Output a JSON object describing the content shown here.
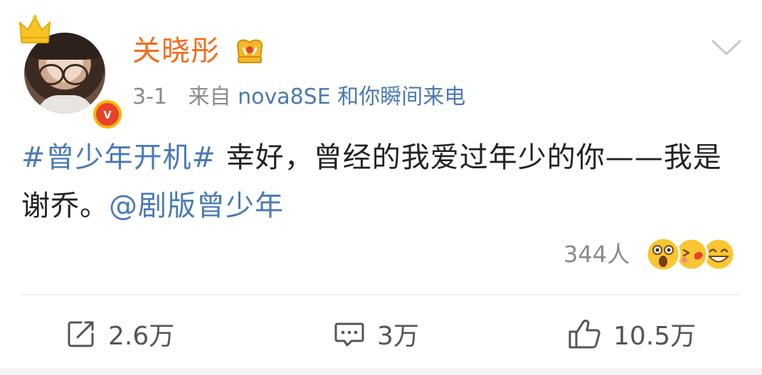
{
  "post": {
    "username": "关晓彤",
    "date": "3-1",
    "source_prefix": "来自",
    "source_device": "nova8SE 和你瞬间来电",
    "verified_mark": "v",
    "content": {
      "hashtag": "#曾少年开机#",
      "text": " 幸好，曾经的我爱过年少的你——我是谢乔。",
      "mention": "@剧版曾少年"
    },
    "reactions": {
      "count": "344人",
      "icons": [
        "surprised-emoji-icon",
        "kiss-emoji-icon",
        "laugh-emoji-icon"
      ]
    },
    "actions": {
      "repost": "2.6万",
      "comment": "3万",
      "like": "10.5万"
    }
  },
  "colors": {
    "username": "#f26d1f",
    "link": "#4a7ab4",
    "meta": "#8a8a8a",
    "badge_gold": "#f7b500",
    "badge_red": "#e8412c"
  }
}
